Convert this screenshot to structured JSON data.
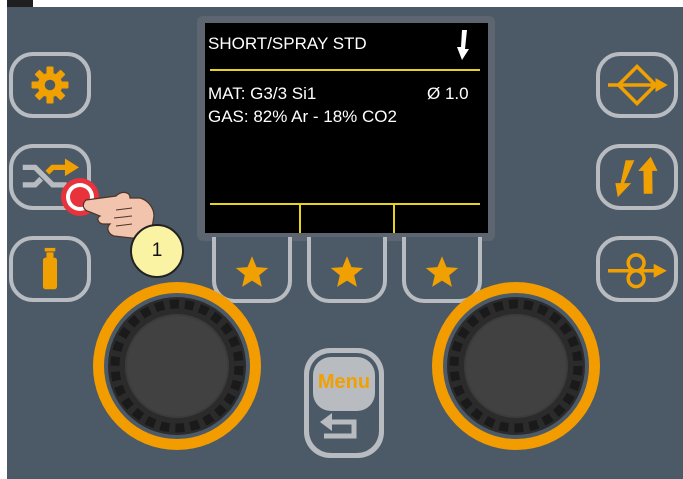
{
  "display": {
    "title": "SHORT/SPRAY STD",
    "material_label": "MAT: G3/3 Si1",
    "wire_diameter": "Ø 1.0",
    "gas_label": "GAS: 82% Ar - 18% CO2"
  },
  "menu_button": {
    "label": "Menu"
  },
  "callout": {
    "number": "1"
  },
  "left_buttons": [
    "gear-icon",
    "shuffle-icon",
    "gas-bottle-icon"
  ],
  "right_buttons": [
    "wire-feed-icon",
    "arrows-updown-icon",
    "wire-inch-icon"
  ],
  "favourites": [
    "star-icon",
    "star-icon",
    "star-icon"
  ],
  "colors": {
    "panel": "#4c5a68",
    "accent_orange": "#f0a000",
    "display_line": "#e6d31a",
    "button_border": "#b8bcc0",
    "callout_fill": "#fbf3a4",
    "press_red": "#e8323c"
  }
}
